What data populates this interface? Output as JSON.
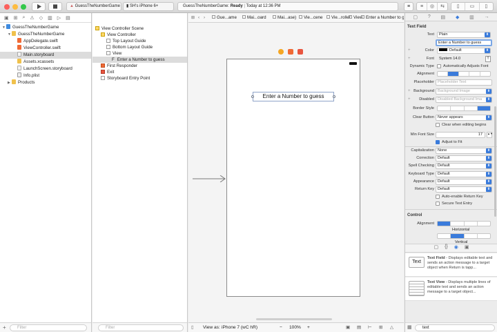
{
  "toolbar": {
    "scheme_target": "GuessTheNumberGame",
    "scheme_device": "SH's iPhone 6+",
    "status_project": "GuessTheNumberGame:",
    "status_state": "Ready",
    "status_time": "Today at 12:36 PM"
  },
  "navigator": {
    "items": [
      {
        "label": "GuessTheNumberGame",
        "kind": "proj",
        "depth": 0
      },
      {
        "label": "GuessTheNumberGame",
        "kind": "folder",
        "depth": 1
      },
      {
        "label": "AppDelegate.swift",
        "kind": "swift",
        "depth": 2
      },
      {
        "label": "ViewController.swift",
        "kind": "swift",
        "depth": 2
      },
      {
        "label": "Main.storyboard",
        "kind": "sb",
        "depth": 2,
        "selected": true
      },
      {
        "label": "Assets.xcassets",
        "kind": "folder",
        "depth": 2
      },
      {
        "label": "LaunchScreen.storyboard",
        "kind": "sb",
        "depth": 2
      },
      {
        "label": "Info.plist",
        "kind": "plist",
        "depth": 2
      },
      {
        "label": "Products",
        "kind": "folder",
        "depth": 1
      }
    ],
    "filter_placeholder": "Filter"
  },
  "outline": {
    "items": [
      {
        "label": "View Controller Scene",
        "depth": 0
      },
      {
        "label": "View Controller",
        "depth": 1
      },
      {
        "label": "Top Layout Guide",
        "depth": 2
      },
      {
        "label": "Bottom Layout Guide",
        "depth": 2
      },
      {
        "label": "View",
        "depth": 2
      },
      {
        "label": "Enter a Number to guess",
        "depth": 3,
        "selected": true,
        "prefix": "F"
      },
      {
        "label": "First Responder",
        "depth": 1
      },
      {
        "label": "Exit",
        "depth": 1
      },
      {
        "label": "Storyboard Entry Point",
        "depth": 1
      }
    ],
    "filter_placeholder": "Filter"
  },
  "jumpbar": {
    "crumbs": [
      "Gue...ame",
      "Mai...oard",
      "Mai...ase)",
      "Vie...cene",
      "Vie...roller",
      "View",
      "Enter a Number to guess"
    ]
  },
  "canvas": {
    "textfield_text": "Enter a Number to guess",
    "view_as_label": "View as:",
    "view_as_device": "iPhone 7 (wC hR)",
    "zoom": "100%"
  },
  "inspector": {
    "section_title": "Text Field",
    "text_label": "Text",
    "text_value": "Plain",
    "text_content": "Enter a Number to guess",
    "color_label": "Color",
    "color_value": "Default",
    "font_label": "Font",
    "font_value": "System 14.0",
    "dynamic_type_label": "Dynamic Type",
    "dynamic_type_value": "Automatically Adjusts Font",
    "alignment_label": "Alignment",
    "placeholder_label": "Placeholder",
    "placeholder_value": "Placeholder Text",
    "background_label": "Background",
    "background_value": "Background Image",
    "disabled_label": "Disabled",
    "disabled_value": "Disabled Background Ima",
    "border_style_label": "Border Style",
    "clear_button_label": "Clear Button",
    "clear_button_value": "Never appears",
    "clear_editing_label": "Clear when editing begins",
    "min_font_label": "Min Font Size",
    "min_font_value": "17",
    "adjust_fit_label": "Adjust to Fit",
    "capitalization_label": "Capitalization",
    "capitalization_value": "None",
    "correction_label": "Correction",
    "correction_value": "Default",
    "spell_label": "Spell Checking",
    "spell_value": "Default",
    "keyboard_type_label": "Keyboard Type",
    "keyboard_type_value": "Default",
    "appearance_label": "Appearance",
    "appearance_value": "Default",
    "return_key_label": "Return Key",
    "return_key_value": "Default",
    "auto_return_label": "Auto-enable Return Key",
    "secure_label": "Secure Text Entry",
    "control_title": "Control",
    "control_alignment_label": "Alignment",
    "horizontal_label": "Horizontal",
    "vertical_label": "Vertical",
    "library": [
      {
        "icon": "Text",
        "title": "Text Field",
        "desc": " - Displays editable text and sends an action message to a target object when Return is tapp..."
      },
      {
        "icon": "",
        "title": "Text View",
        "desc": " - Displays multiple lines of editable text and sends an action message to a target object..."
      }
    ],
    "library_search": "text"
  }
}
